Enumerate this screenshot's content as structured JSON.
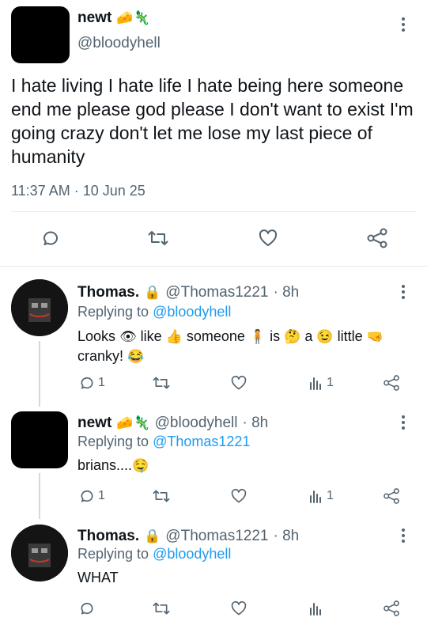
{
  "main_tweet": {
    "display_name": "newt",
    "name_emoji": "🧀🦎",
    "handle": "@bloodyhell",
    "text": "I hate living I hate life I hate being here someone end me please god please I don't want to exist I'm going crazy don't let me lose my last piece of humanity",
    "timestamp": "11:37 AM · 10 Jun 25",
    "actions": [
      "reply-icon",
      "retweet-icon",
      "like-icon",
      "share-icon"
    ]
  },
  "replies": [
    {
      "display_name": "Thomas.",
      "badge": "🔒",
      "handle": "@Thomas1221",
      "time": "· 8h",
      "replying_label": "Replying to",
      "replying_to": "@bloodyhell",
      "text_parts": [
        "Looks",
        "👁",
        "like",
        "👍",
        "someone",
        "🧍",
        "is",
        "🤔",
        "a",
        "😉",
        "little",
        "🤜",
        "cranky!",
        "😂"
      ],
      "reply_count": "1",
      "views_count": "1"
    },
    {
      "display_name": "newt",
      "name_emoji": "🧀🦎",
      "handle": "@bloodyhell",
      "time": "· 8h",
      "replying_label": "Replying to",
      "replying_to": "@Thomas1221",
      "text": "brians....",
      "text_emoji": "🤤",
      "reply_count": "1",
      "views_count": "1"
    },
    {
      "display_name": "Thomas.",
      "badge": "🔒",
      "handle": "@Thomas1221",
      "time": "· 8h",
      "replying_label": "Replying to",
      "replying_to": "@bloodyhell",
      "text": "WHAT"
    }
  ],
  "colors": {
    "link": "#1d9bf0",
    "muted": "#536471",
    "text": "#0f1419"
  }
}
